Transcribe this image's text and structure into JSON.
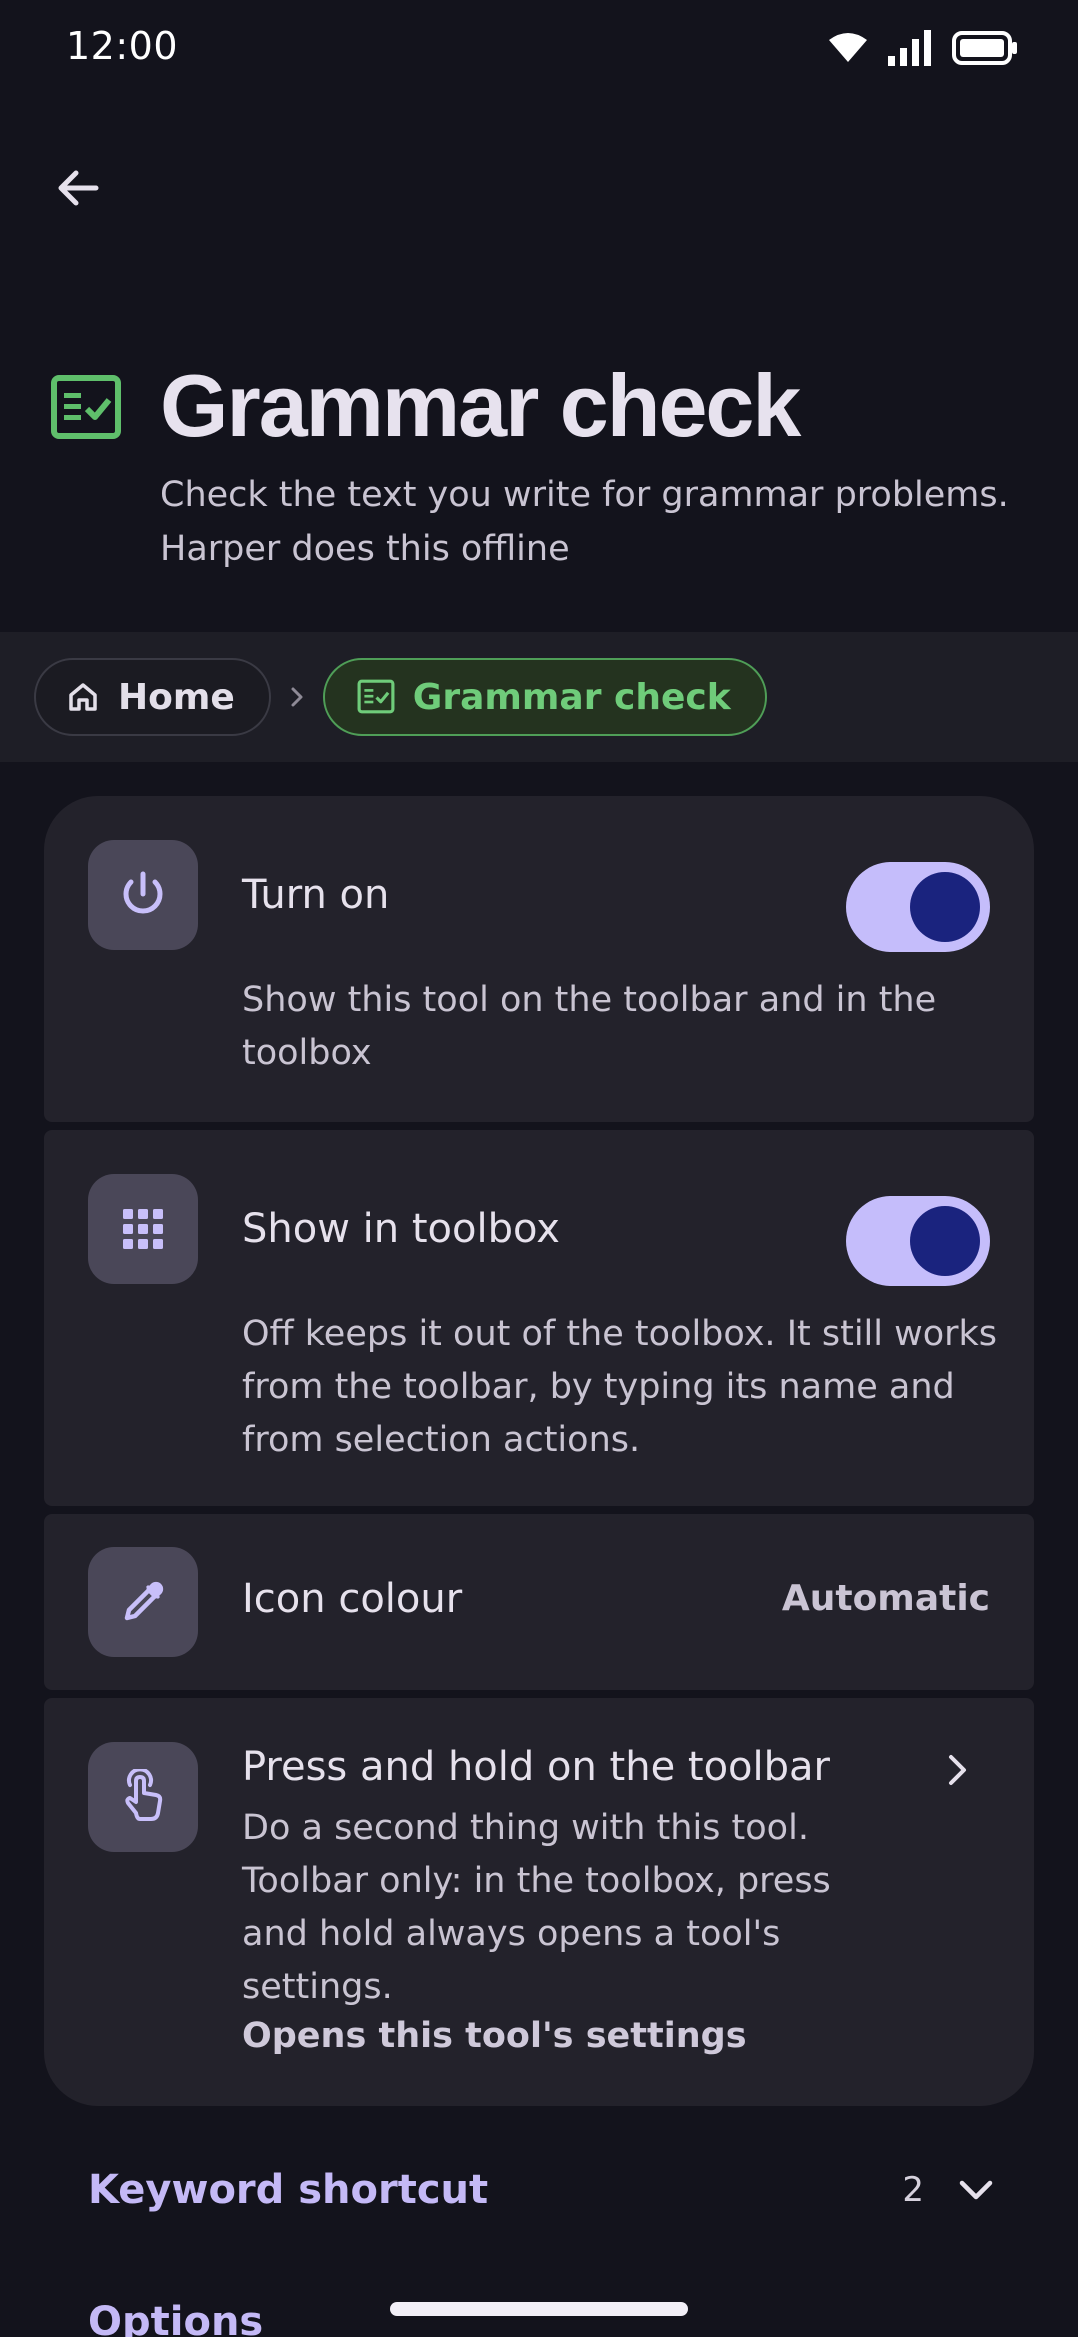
{
  "status_bar": {
    "time": "12:00",
    "icons": [
      "wifi-icon",
      "cellular-signal-icon",
      "battery-icon"
    ]
  },
  "nav": {
    "back_icon": "arrow-left-icon"
  },
  "header": {
    "icon": "fact-check-icon",
    "title": "Grammar check",
    "subtitle": "Check the text you write for grammar problems. Harper does this offline"
  },
  "breadcrumb": {
    "items": [
      {
        "label": "Home",
        "icon": "home-icon"
      },
      {
        "label": "Grammar check",
        "icon": "fact-check-icon",
        "current": true
      }
    ],
    "separator_icon": "chevron-right-icon"
  },
  "settings": [
    {
      "icon": "power-icon",
      "title": "Turn on",
      "description": "Show this tool on the toolbar and in the toolbox",
      "toggle": true
    },
    {
      "icon": "apps-grid-icon",
      "title": "Show in toolbox",
      "description": "Off keeps it out of the toolbox. It still works from the toolbar, by typing its name and from selection actions.",
      "toggle": true
    },
    {
      "icon": "colorize-icon",
      "title": "Icon colour",
      "value": "Automatic"
    },
    {
      "icon": "touch-hold-icon",
      "title": "Press and hold on the toolbar",
      "description": "Do a second thing with this tool. Toolbar only: in the toolbox, press and hold always opens a tool's settings.",
      "current_value": "Opens this tool's settings"
    }
  ],
  "sections": [
    {
      "label": "Keyword shortcut",
      "count": "2",
      "icon": "chevron-down-icon"
    },
    {
      "label": "Options"
    }
  ],
  "colors": {
    "background": "#13131c",
    "card": "#23222b",
    "accent_green": "#6fcc7a",
    "toggle_track": "#c5bdfb",
    "toggle_knob": "#1a237e",
    "section_label": "#c4b9f6"
  }
}
